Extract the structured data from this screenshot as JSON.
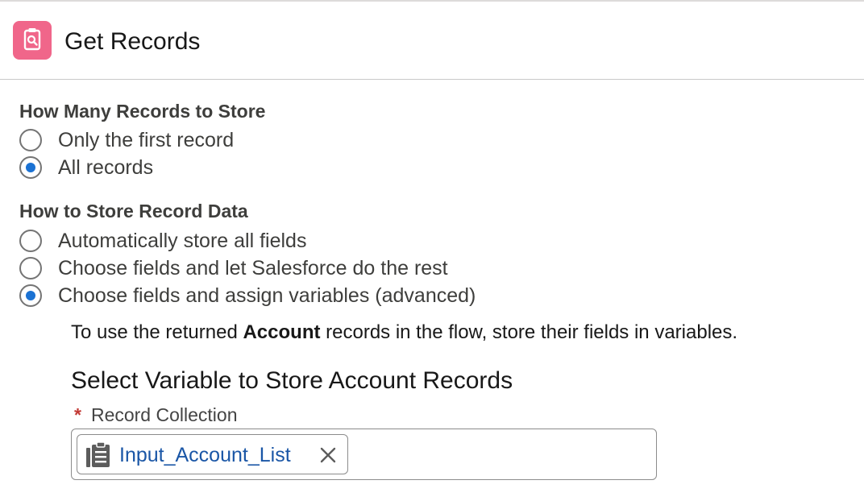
{
  "header": {
    "title": "Get Records",
    "icon": "record-lookup-icon",
    "icon_color": "#f0668a"
  },
  "record_count": {
    "heading": "How Many Records to Store",
    "options": [
      {
        "label": "Only the first record",
        "checked": false
      },
      {
        "label": "All records",
        "checked": true
      }
    ]
  },
  "store_data": {
    "heading": "How to Store Record Data",
    "options": [
      {
        "label": "Automatically store all fields",
        "checked": false
      },
      {
        "label": "Choose fields and let Salesforce do the rest",
        "checked": false
      },
      {
        "label": "Choose fields and assign variables (advanced)",
        "checked": true
      }
    ]
  },
  "advanced": {
    "info_prefix": "To use the returned ",
    "info_object": "Account",
    "info_suffix": " records in the flow, store their fields in variables.",
    "subheading": "Select Variable to Store Account Records",
    "field_required_marker": "*",
    "field_label": "Record Collection",
    "selected_variable": "Input_Account_List",
    "selected_variable_icon": "record-collection-icon",
    "remove_icon": "close-icon"
  },
  "colors": {
    "accent": "#1b72d3",
    "link": "#1a56a6",
    "required": "#c23934"
  }
}
